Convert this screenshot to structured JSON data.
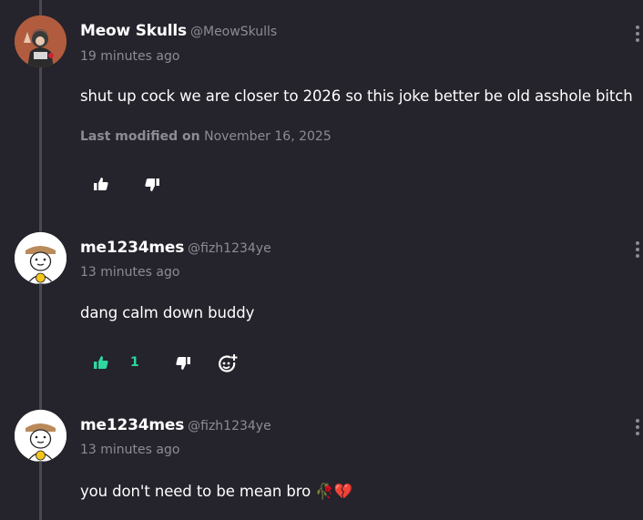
{
  "comments": [
    {
      "author_name": "Meow Skulls",
      "author_handle": "@MeowSkulls",
      "time": "19 minutes ago",
      "text": "shut up cock we are closer to 2026 so this joke better be old asshole bitch",
      "modified_label": "Last modified on",
      "modified_date": "November 16, 2025"
    },
    {
      "author_name": "me1234mes",
      "author_handle": "@fizh1234ye",
      "time": "13 minutes ago",
      "text": "dang calm down buddy",
      "like_count": "1"
    },
    {
      "author_name": "me1234mes",
      "author_handle": "@fizh1234ye",
      "time": "13 minutes ago",
      "text": "you don't need to be mean bro 🥀💔"
    }
  ],
  "colors": {
    "background": "#25232b",
    "muted_text": "#8d8b93",
    "liked_accent": "#2fd6a0",
    "icon": "#ffffff"
  },
  "icons": [
    "thumbs-up-icon",
    "thumbs-down-icon",
    "add-reaction-icon",
    "more-options-icon"
  ]
}
